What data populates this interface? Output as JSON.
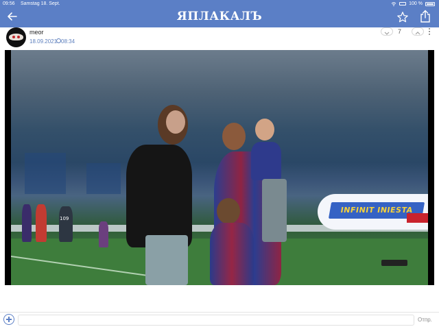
{
  "status_bar": {
    "time": "09:56",
    "date": "Samstag 18. Sept.",
    "battery": "100 %",
    "icons": [
      "wifi-icon",
      "sim-icon",
      "battery-icon"
    ]
  },
  "header": {
    "logo": "ЯПЛАКАЛЪ",
    "background_color": "#5b7fc6",
    "icons": [
      "back-arrow-icon",
      "star-icon",
      "share-icon"
    ]
  },
  "post": {
    "author": "meor",
    "date": "18.09.2021",
    "time": "08:34",
    "vote_count": "7",
    "icons": [
      "avatar-icon",
      "clock-icon",
      "vote-down-icon",
      "vote-up-icon",
      "more-icon"
    ]
  },
  "video": {
    "banner_text": "INFINIT INIESTA",
    "jersey_number": "109"
  },
  "comment_bar": {
    "input_value": "",
    "send_label": "Отпр.",
    "icons": [
      "add-icon"
    ]
  }
}
